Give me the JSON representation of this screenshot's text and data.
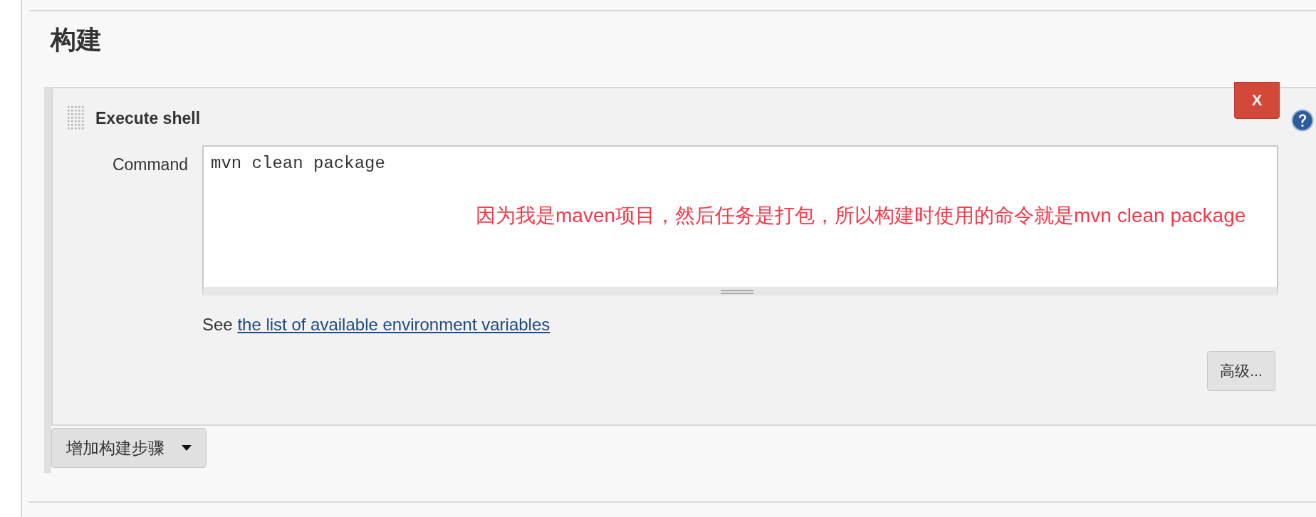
{
  "section": {
    "title": "构建"
  },
  "build_step": {
    "title": "Execute shell",
    "delete_label": "X",
    "command_label": "Command",
    "command_value": "mvn clean package",
    "annotation": "因为我是maven项目，然后任务是打包，所以构建时使用的命令就是mvn clean package",
    "see_text": "See",
    "env_link": "the list of available environment variables",
    "advanced_label": "高级..."
  },
  "add_step": {
    "label": "增加构建步骤"
  }
}
